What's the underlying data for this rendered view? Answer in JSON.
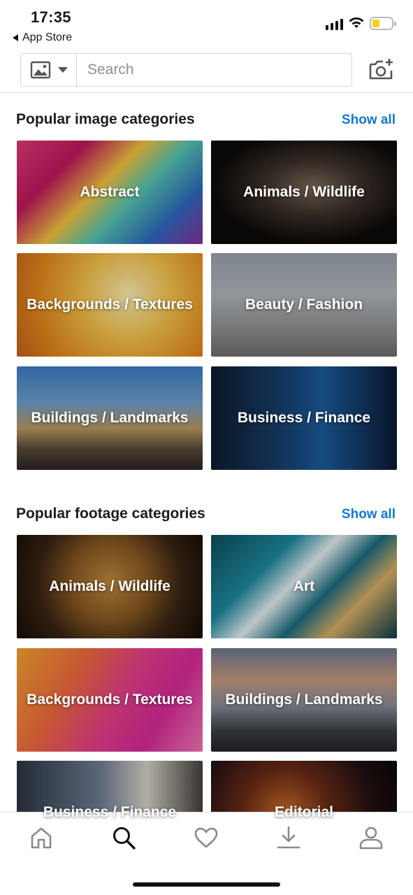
{
  "status_bar": {
    "time": "17:35",
    "back_label": "App Store"
  },
  "search": {
    "placeholder": "Search",
    "type_icon": "image-icon",
    "camera_icon": "camera-plus-icon"
  },
  "image_section": {
    "title": "Popular image categories",
    "show_all": "Show all",
    "tiles": [
      {
        "label": "Abstract"
      },
      {
        "label": "Animals / Wildlife"
      },
      {
        "label": "Backgrounds / Textures"
      },
      {
        "label": "Beauty / Fashion"
      },
      {
        "label": "Buildings / Landmarks"
      },
      {
        "label": "Business / Finance"
      }
    ]
  },
  "footage_section": {
    "title": "Popular footage categories",
    "show_all": "Show all",
    "tiles": [
      {
        "label": "Animals / Wildlife"
      },
      {
        "label": "Art"
      },
      {
        "label": "Backgrounds / Textures"
      },
      {
        "label": "Buildings / Landmarks"
      },
      {
        "label": "Business / Finance"
      },
      {
        "label": "Editorial"
      }
    ]
  },
  "bottom_nav": {
    "items": [
      {
        "icon": "home-icon",
        "active": false
      },
      {
        "icon": "search-icon",
        "active": true
      },
      {
        "icon": "heart-icon",
        "active": false
      },
      {
        "icon": "download-icon",
        "active": false
      },
      {
        "icon": "profile-icon",
        "active": false
      }
    ]
  },
  "colors": {
    "accent": "#1577cf",
    "text": "#1c1c1c",
    "icon_inactive": "#8a8a8a",
    "icon_active": "#111111"
  }
}
